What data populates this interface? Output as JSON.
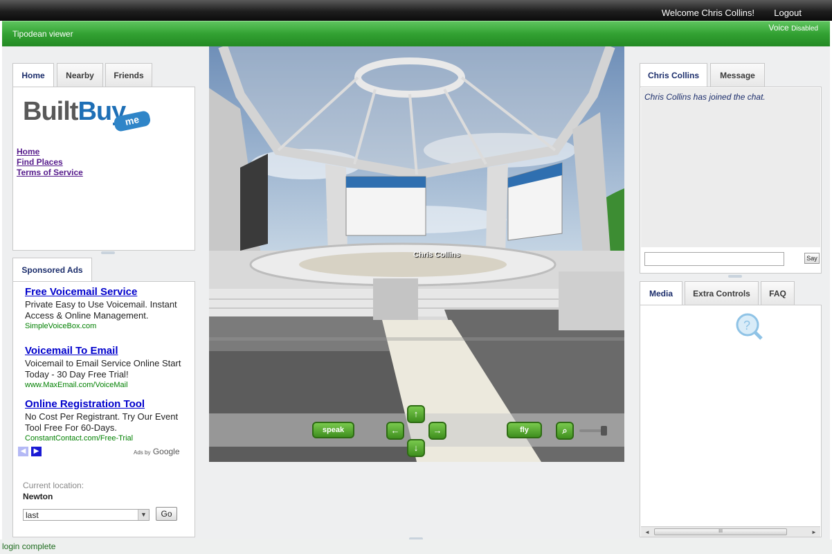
{
  "header": {
    "welcome": "Welcome Chris Collins!",
    "logout": "Logout",
    "app_title": "Tipodean viewer",
    "voice_label": "Voice",
    "voice_status": "Disabled"
  },
  "left": {
    "tabs": [
      "Home",
      "Nearby",
      "Friends"
    ],
    "active_tab": "Home",
    "logo": {
      "built": "Built",
      "buy": "Buy",
      "me": "me"
    },
    "links": [
      "Home",
      "Find Places",
      "Terms of Service"
    ],
    "ads_tab": "Sponsored Ads",
    "ads": [
      {
        "title": "Free Voicemail Service",
        "desc": "Private Easy to Use Voicemail. Instant Access & Online Management.",
        "url": "SimpleVoiceBox.com"
      },
      {
        "title": "Voicemail To Email",
        "desc": "Voicemail to Email Service Online Start Today - 30 Day Free Trial!",
        "url": "www.MaxEmail.com/VoiceMail"
      },
      {
        "title": "Online Registration Tool",
        "desc": "No Cost Per Registrant. Try Our Event Tool Free For 60-Days.",
        "url": "ConstantContact.com/Free-Trial"
      }
    ],
    "ads_by": "Ads by",
    "ads_by_brand": "Google",
    "current_location_label": "Current location:",
    "current_location_value": "Newton",
    "location_select_value": "last",
    "go_label": "Go"
  },
  "viewer": {
    "avatar_label": "Chris Collins",
    "speak_label": "speak",
    "fly_label": "fly",
    "controls": {
      "up": "↑",
      "left": "←",
      "right": "→",
      "down": "↓"
    }
  },
  "right": {
    "chat_tabs": [
      "Chris Collins",
      "Message"
    ],
    "chat_message": "Chris Collins has joined the chat.",
    "say_label": "Say",
    "media_tabs": [
      "Media",
      "Extra Controls",
      "FAQ"
    ],
    "scroll_left": "◄",
    "scroll_right": "►",
    "scroll_grip": "III"
  },
  "status": {
    "text": "login complete"
  },
  "colors": {
    "green_bar": "#32a132",
    "top_bar": "#1e1e1e",
    "link_visited": "#551a8b",
    "ad_title": "#0000cc",
    "ad_url": "#008000",
    "control_green": "#4fa82c"
  }
}
